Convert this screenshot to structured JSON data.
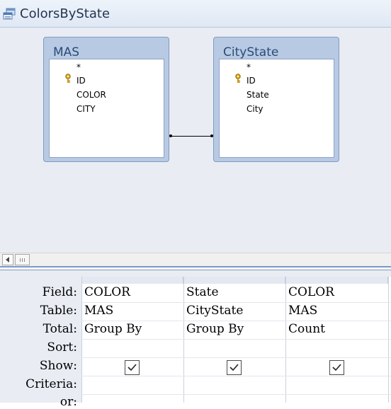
{
  "window": {
    "title": "ColorsByState"
  },
  "tables": [
    {
      "name": "MAS",
      "fields": [
        "*",
        "ID",
        "COLOR",
        "CITY"
      ]
    },
    {
      "name": "CityState",
      "fields": [
        "*",
        "ID",
        "State",
        "City"
      ]
    }
  ],
  "grid": {
    "row_labels": [
      "Field:",
      "Table:",
      "Total:",
      "Sort:",
      "Show:",
      "Criteria:",
      "or:"
    ],
    "columns": [
      {
        "field": "COLOR",
        "table": "MAS",
        "total": "Group By",
        "sort": "",
        "show": true,
        "criteria": ""
      },
      {
        "field": "State",
        "table": "CityState",
        "total": "Group By",
        "sort": "",
        "show": true,
        "criteria": ""
      },
      {
        "field": "COLOR",
        "table": "MAS",
        "total": "Count",
        "sort": "",
        "show": true,
        "criteria": ""
      }
    ]
  },
  "icons": {
    "title": "query-icon",
    "primary_key": "key-icon",
    "scroll_left": "scroll-left-arrow-icon",
    "checkbox": "checkmark-icon"
  },
  "colors": {
    "table_header": "#b8cae3",
    "table_title_text": "#2a4b78",
    "design_surface": "#e9ecf3",
    "splitter": "#7a97c3"
  }
}
